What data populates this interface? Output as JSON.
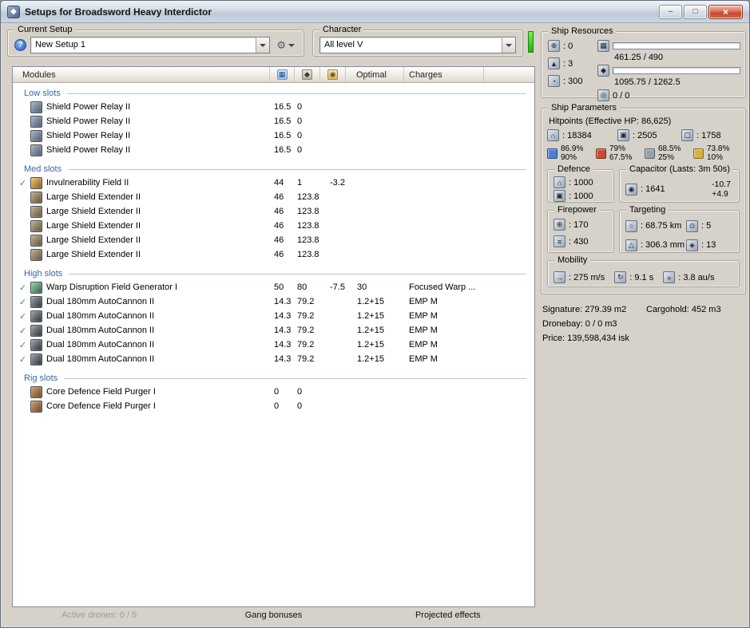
{
  "window": {
    "title": "Setups for Broadsword Heavy Interdictor"
  },
  "icons": {
    "app": "◆",
    "window_min": "–",
    "window_max": "□",
    "window_close": "×",
    "help": "?",
    "tools": "⚙",
    "check": "✓",
    "cpu": "▦",
    "powergrid": "◆",
    "capacitor_col": "◉",
    "turret": "⊕",
    "launcher": "▲",
    "bandwidth": "◔",
    "calibration": "◎",
    "shield": "∩",
    "armor": "▣",
    "hull": "▢",
    "defence_shield": "∩",
    "defence_tank": "▣",
    "capacitor": "◉",
    "volley": "⊕",
    "dps": "≡",
    "range": "○",
    "max_targets": "⊙",
    "scan_res": "△",
    "sensor": "◈",
    "speed": "→",
    "align": "↻",
    "warp": "»"
  },
  "current_setup": {
    "label": "Current Setup",
    "value": "New Setup 1"
  },
  "character": {
    "label": "Character",
    "value": "All level V"
  },
  "modules_table": {
    "header": {
      "modules": "Modules",
      "optimal": "Optimal",
      "charges": "Charges"
    },
    "sections": [
      {
        "title": "Low slots",
        "rows": [
          {
            "active": false,
            "icon": "shield-power-relay-icon",
            "name": "Shield Power Relay II",
            "cpu": "16.5",
            "pg": "0",
            "cap": "",
            "optimal": "",
            "charge": ""
          },
          {
            "active": false,
            "icon": "shield-power-relay-icon",
            "name": "Shield Power Relay II",
            "cpu": "16.5",
            "pg": "0",
            "cap": "",
            "optimal": "",
            "charge": ""
          },
          {
            "active": false,
            "icon": "shield-power-relay-icon",
            "name": "Shield Power Relay II",
            "cpu": "16.5",
            "pg": "0",
            "cap": "",
            "optimal": "",
            "charge": ""
          },
          {
            "active": false,
            "icon": "shield-power-relay-icon",
            "name": "Shield Power Relay II",
            "cpu": "16.5",
            "pg": "0",
            "cap": "",
            "optimal": "",
            "charge": ""
          }
        ]
      },
      {
        "title": "Med slots",
        "rows": [
          {
            "active": true,
            "icon": "invulnerability-field-icon",
            "name": "Invulnerability Field II",
            "cpu": "44",
            "pg": "1",
            "cap": "-3.2",
            "optimal": "",
            "charge": ""
          },
          {
            "active": false,
            "icon": "large-shield-extender-icon",
            "name": "Large Shield Extender II",
            "cpu": "46",
            "pg": "123.8",
            "cap": "",
            "optimal": "",
            "charge": ""
          },
          {
            "active": false,
            "icon": "large-shield-extender-icon",
            "name": "Large Shield Extender II",
            "cpu": "46",
            "pg": "123.8",
            "cap": "",
            "optimal": "",
            "charge": ""
          },
          {
            "active": false,
            "icon": "large-shield-extender-icon",
            "name": "Large Shield Extender II",
            "cpu": "46",
            "pg": "123.8",
            "cap": "",
            "optimal": "",
            "charge": ""
          },
          {
            "active": false,
            "icon": "large-shield-extender-icon",
            "name": "Large Shield Extender II",
            "cpu": "46",
            "pg": "123.8",
            "cap": "",
            "optimal": "",
            "charge": ""
          },
          {
            "active": false,
            "icon": "large-shield-extender-icon",
            "name": "Large Shield Extender II",
            "cpu": "46",
            "pg": "123.8",
            "cap": "",
            "optimal": "",
            "charge": ""
          }
        ]
      },
      {
        "title": "High slots",
        "rows": [
          {
            "active": true,
            "icon": "warp-disruption-generator-icon",
            "name": "Warp Disruption Field Generator I",
            "cpu": "50",
            "pg": "80",
            "cap": "-7.5",
            "optimal": "30",
            "charge": "Focused Warp ..."
          },
          {
            "active": true,
            "icon": "autocannon-icon",
            "name": "Dual 180mm AutoCannon II",
            "cpu": "14.3",
            "pg": "79.2",
            "cap": "",
            "optimal": "1.2+15",
            "charge": "EMP M"
          },
          {
            "active": true,
            "icon": "autocannon-icon",
            "name": "Dual 180mm AutoCannon II",
            "cpu": "14.3",
            "pg": "79.2",
            "cap": "",
            "optimal": "1.2+15",
            "charge": "EMP M"
          },
          {
            "active": true,
            "icon": "autocannon-icon",
            "name": "Dual 180mm AutoCannon II",
            "cpu": "14.3",
            "pg": "79.2",
            "cap": "",
            "optimal": "1.2+15",
            "charge": "EMP M"
          },
          {
            "active": true,
            "icon": "autocannon-icon",
            "name": "Dual 180mm AutoCannon II",
            "cpu": "14.3",
            "pg": "79.2",
            "cap": "",
            "optimal": "1.2+15",
            "charge": "EMP M"
          },
          {
            "active": true,
            "icon": "autocannon-icon",
            "name": "Dual 180mm AutoCannon II",
            "cpu": "14.3",
            "pg": "79.2",
            "cap": "",
            "optimal": "1.2+15",
            "charge": "EMP M"
          }
        ]
      },
      {
        "title": "Rig slots",
        "rows": [
          {
            "active": false,
            "icon": "rig-purger-icon",
            "name": "Core Defence Field Purger I",
            "cpu": "0",
            "pg": "0",
            "cap": "",
            "optimal": "",
            "charge": ""
          },
          {
            "active": false,
            "icon": "rig-purger-icon",
            "name": "Core Defence Field Purger I",
            "cpu": "0",
            "pg": "0",
            "cap": "",
            "optimal": "",
            "charge": ""
          }
        ]
      }
    ]
  },
  "ship_resources": {
    "label": "Ship Resources",
    "hardpoints": [
      {
        "value": ": 0"
      },
      {
        "value": ": 3"
      },
      {
        "value": ": 300"
      }
    ],
    "cpu_gauge": {
      "text": "461.25 / 490",
      "fill": 94
    },
    "powergrid_gauge": {
      "text": "1095.75 / 1262.5",
      "fill": 87
    },
    "calibration_gauge": {
      "text": "0 / 0",
      "fill": 0
    }
  },
  "ship_parameters": {
    "label": "Ship Parameters",
    "hitpoints_title": "Hitpoints (Effective HP: 86,625)",
    "hitpoints": [
      {
        "value": ": 18384"
      },
      {
        "value": ": 2505"
      },
      {
        "value": ": 1758"
      }
    ],
    "resists": [
      {
        "color": "#4d7fd2",
        "shield": "86.9%",
        "armor": "90%"
      },
      {
        "color": "#c94a35",
        "shield": "79%",
        "armor": "67.5%"
      },
      {
        "color": "#97a1a9",
        "shield": "68.5%",
        "armor": "25%"
      },
      {
        "color": "#d7b13e",
        "shield": "73.8%",
        "armor": "10%"
      }
    ],
    "defence": {
      "label": "Defence",
      "values": [
        ": 1000",
        ": 1000"
      ]
    },
    "capacitor": {
      "label": "Capacitor (Lasts: 3m 50s)",
      "amount": ": 1641",
      "out": "-10.7",
      "in": "+4.9"
    },
    "firepower": {
      "label": "Firepower",
      "volley": ": 170",
      "dps": ": 430"
    },
    "targeting": {
      "label": "Targeting",
      "range": ": 68.75 km",
      "max_targets": ": 5",
      "scan_res": ": 306.3 mm",
      "sensor": ": 13"
    },
    "mobility": {
      "label": "Mobility",
      "speed": ": 275 m/s",
      "align": ": 9.1 s",
      "warp": ": 3.8 au/s"
    }
  },
  "summary": {
    "signature": "Signature: 279.39 m2",
    "cargohold": "Cargohold: 452 m3",
    "dronebay": "Dronebay: 0 / 0 m3",
    "price": "Price: 139,598,434 isk"
  },
  "bottom_panels": {
    "active_drones": "Active drones: 0 / 5",
    "gang_bonuses": "Gang bonuses",
    "projected_effects": "Projected effects"
  }
}
